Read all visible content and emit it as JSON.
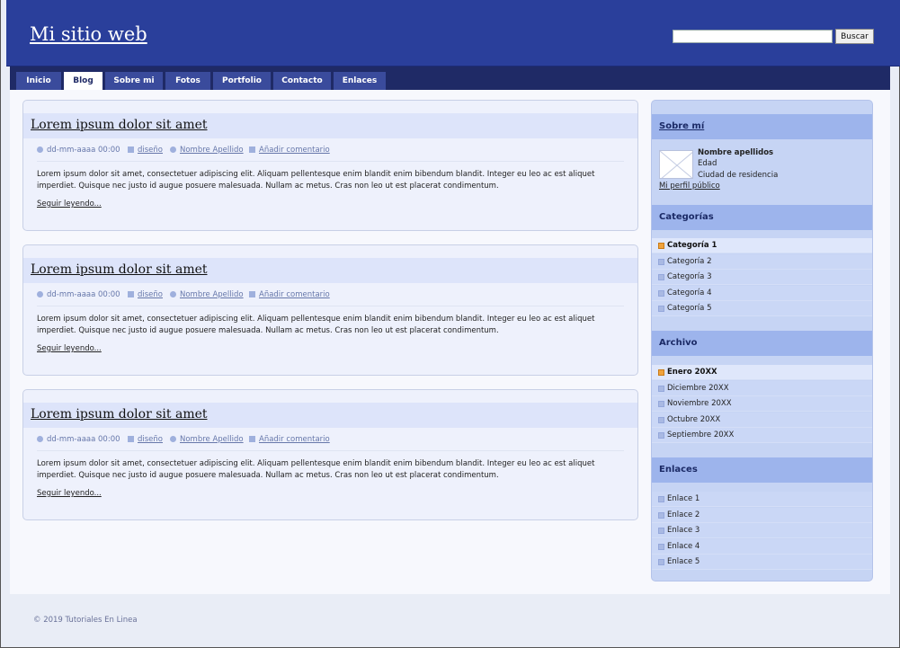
{
  "header": {
    "site_title": "Mi sitio web",
    "search_placeholder": "",
    "search_button": "Buscar"
  },
  "nav": {
    "tabs": [
      {
        "label": "Inicio"
      },
      {
        "label": "Blog"
      },
      {
        "label": "Sobre mi"
      },
      {
        "label": "Fotos"
      },
      {
        "label": "Portfolio"
      },
      {
        "label": "Contacto"
      },
      {
        "label": "Enlaces"
      }
    ],
    "active": "Blog"
  },
  "posts": [
    {
      "title": "Lorem ipsum dolor sit amet",
      "date": "dd-mm-aaaa 00:00",
      "category": "diseño",
      "author": "Nombre Apellido",
      "comment": "Añadir comentario",
      "body": "Lorem ipsum dolor sit amet, consectetuer adipiscing elit. Aliquam pellentesque enim blandit enim bibendum blandit. Integer eu leo ac est aliquet imperdiet. Quisque nec justo id augue posuere malesuada. Nullam ac metus. Cras non leo ut est placerat condimentum.",
      "read_more": "Seguir leyendo..."
    },
    {
      "title": "Lorem ipsum dolor sit amet",
      "date": "dd-mm-aaaa 00:00",
      "category": "diseño",
      "author": "Nombre Apellido",
      "comment": "Añadir comentario",
      "body": "Lorem ipsum dolor sit amet, consectetuer adipiscing elit. Aliquam pellentesque enim blandit enim bibendum blandit. Integer eu leo ac est aliquet imperdiet. Quisque nec justo id augue posuere malesuada. Nullam ac metus. Cras non leo ut est placerat condimentum.",
      "read_more": "Seguir leyendo..."
    },
    {
      "title": "Lorem ipsum dolor sit amet",
      "date": "dd-mm-aaaa 00:00",
      "category": "diseño",
      "author": "Nombre Apellido",
      "comment": "Añadir comentario",
      "body": "Lorem ipsum dolor sit amet, consectetuer adipiscing elit. Aliquam pellentesque enim blandit enim bibendum blandit. Integer eu leo ac est aliquet imperdiet. Quisque nec justo id augue posuere malesuada. Nullam ac metus. Cras non leo ut est placerat condimentum.",
      "read_more": "Seguir leyendo..."
    }
  ],
  "sidebar": {
    "about": {
      "heading": "Sobre mí",
      "name": "Nombre apellidos",
      "age": "Edad",
      "city": "Ciudad de residencia",
      "profile_link": "Mi perfil público"
    },
    "categories": {
      "heading": "Categorías",
      "items": [
        "Categoría 1",
        "Categoría 2",
        "Categoría 3",
        "Categoría 4",
        "Categoría 5"
      ]
    },
    "archive": {
      "heading": "Archivo",
      "items": [
        "Enero 20XX",
        "Diciembre 20XX",
        "Noviembre 20XX",
        "Octubre 20XX",
        "Septiembre 20XX"
      ]
    },
    "links": {
      "heading": "Enlaces",
      "items": [
        "Enlace 1",
        "Enlace 2",
        "Enlace 3",
        "Enlace 4",
        "Enlace 5"
      ]
    }
  },
  "footer": {
    "text": "© 2019 Tutoriales En Linea"
  },
  "colors": {
    "header_bg": "#2a3f9b",
    "nav_bg": "#1f2a66",
    "tab_bg": "#3a4b9c",
    "accent_bullet": "#f0a33c"
  }
}
